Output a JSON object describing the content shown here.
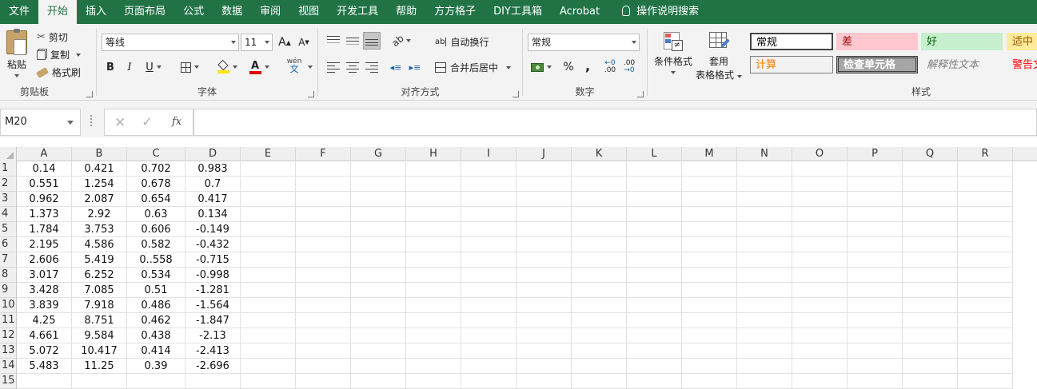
{
  "menu": {
    "items": [
      "文件",
      "开始",
      "插入",
      "页面布局",
      "公式",
      "数据",
      "审阅",
      "视图",
      "开发工具",
      "帮助",
      "方方格子",
      "DIY工具箱",
      "Acrobat"
    ],
    "active_index": 1,
    "search_label": "操作说明搜索"
  },
  "ribbon": {
    "clipboard": {
      "paste": "粘贴",
      "cut": "剪切",
      "copy": "复制",
      "format_painter": "格式刷",
      "label": "剪贴板"
    },
    "font": {
      "name": "等线",
      "size": "11",
      "grow": "A",
      "shrink": "A",
      "bold": "B",
      "italic": "I",
      "underline": "U",
      "wen": "wén",
      "wen2": "文",
      "label": "字体"
    },
    "alignment": {
      "wrap": "自动换行",
      "merge": "合并后居中",
      "label": "对齐方式"
    },
    "number": {
      "format": "常规",
      "percent": "%",
      "comma": ",",
      "dec_inc": ".00",
      "dec_dec": ".00",
      "label": "数字"
    },
    "styles": {
      "conditional": "条件格式",
      "table_line1": "套用",
      "table_line2": "表格格式",
      "cells": [
        {
          "text": "常规",
          "bg": "#ffffff",
          "color": "#000000",
          "border": "#444444"
        },
        {
          "text": "差",
          "bg": "#ffc7ce",
          "color": "#9c0006",
          "border": "#ffc7ce"
        },
        {
          "text": "好",
          "bg": "#c6efce",
          "color": "#006100",
          "border": "#c6efce"
        },
        {
          "text": "适中",
          "bg": "#ffeb9c",
          "color": "#9c5700",
          "border": "#ffeb9c"
        },
        {
          "text": "计算",
          "bg": "#f2f2f2",
          "color": "#fa7d00",
          "border": "#7f7f7f"
        },
        {
          "text": "检查单元格",
          "bg": "#a5a5a5",
          "color": "#ffffff",
          "border": "#3f3f3f"
        },
        {
          "text": "解释性文本",
          "bg": "#f3f3f3",
          "color": "#7f7f7f",
          "border": "#f3f3f3"
        },
        {
          "text": "警告文本",
          "bg": "#f3f3f3",
          "color": "#ff0000",
          "border": "#f3f3f3"
        }
      ],
      "label": "样式"
    }
  },
  "formula_bar": {
    "name_box": "M20",
    "fx": "fx",
    "formula": ""
  },
  "sheet": {
    "columns": [
      "A",
      "B",
      "C",
      "D",
      "E",
      "F",
      "G",
      "H",
      "I",
      "J",
      "K",
      "L",
      "M",
      "N",
      "O",
      "P",
      "Q",
      "R"
    ],
    "rows": [
      [
        "0.14",
        "0.421",
        "0.702",
        "0.983"
      ],
      [
        "0.551",
        "1.254",
        "0.678",
        "0.7"
      ],
      [
        "0.962",
        "2.087",
        "0.654",
        "0.417"
      ],
      [
        "1.373",
        "2.92",
        "0.63",
        "0.134"
      ],
      [
        "1.784",
        "3.753",
        "0.606",
        "-0.149"
      ],
      [
        "2.195",
        "4.586",
        "0.582",
        "-0.432"
      ],
      [
        "2.606",
        "5.419",
        "0..558",
        "-0.715"
      ],
      [
        "3.017",
        "6.252",
        "0.534",
        "-0.998"
      ],
      [
        "3.428",
        "7.085",
        "0.51",
        "-1.281"
      ],
      [
        "3.839",
        "7.918",
        "0.486",
        "-1.564"
      ],
      [
        "4.25",
        "8.751",
        "0.462",
        "-1.847"
      ],
      [
        "4.661",
        "9.584",
        "0.438",
        "-2.13"
      ],
      [
        "5.072",
        "10.417",
        "0.414",
        "-2.413"
      ],
      [
        "5.483",
        "11.25",
        "0.39",
        "-2.696"
      ],
      [
        "",
        "",
        "",
        ""
      ]
    ],
    "row_labels": [
      "1",
      "2",
      "3",
      "4",
      "5",
      "6",
      "7",
      "8",
      "9",
      "10",
      "11",
      "12",
      "13",
      "14",
      "15"
    ]
  }
}
